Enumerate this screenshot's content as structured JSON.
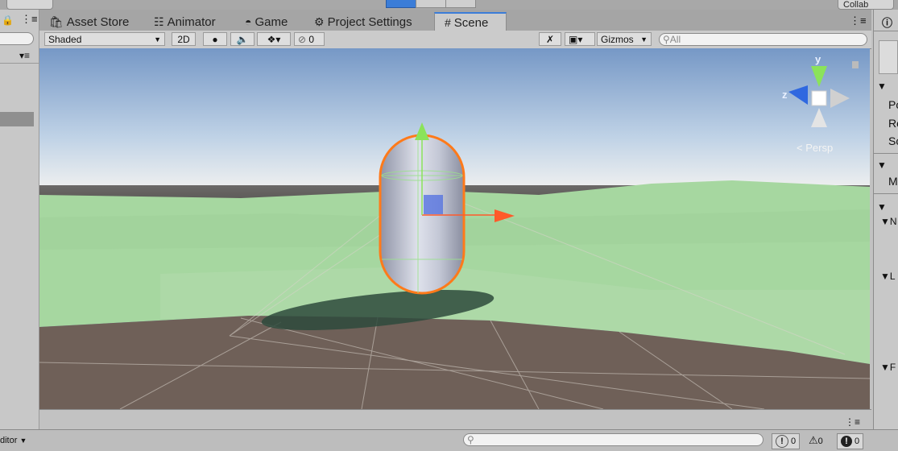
{
  "top": {
    "collab_label": "Collab"
  },
  "tabs": [
    {
      "label": "Asset Store",
      "icon": "asset-store-icon"
    },
    {
      "label": "Animator",
      "icon": "animator-icon"
    },
    {
      "label": "Game",
      "icon": "game-icon"
    },
    {
      "label": "Project Settings",
      "icon": "gear-icon"
    },
    {
      "label": "Scene",
      "icon": "grid-icon",
      "active": true
    }
  ],
  "toolbar": {
    "shading_mode": "Shaded",
    "mode_2d": "2D",
    "hidden_count": "0",
    "gizmos": "Gizmos",
    "search_placeholder": "All"
  },
  "scene": {
    "projection": "Persp",
    "axis_y": "y",
    "axis_z": "z"
  },
  "inspector": {
    "rows": [
      "Po",
      "Ro",
      "Sc",
      "M",
      "N",
      "L",
      "F"
    ]
  },
  "status": {
    "editor_label": "ditor",
    "errors": "0",
    "warnings": "0",
    "messages": "0"
  },
  "colors": {
    "accent": "#3b7dd8",
    "selection": "#ff7a1a",
    "ground": "#a3d49b",
    "plane": "#6e5f57"
  }
}
